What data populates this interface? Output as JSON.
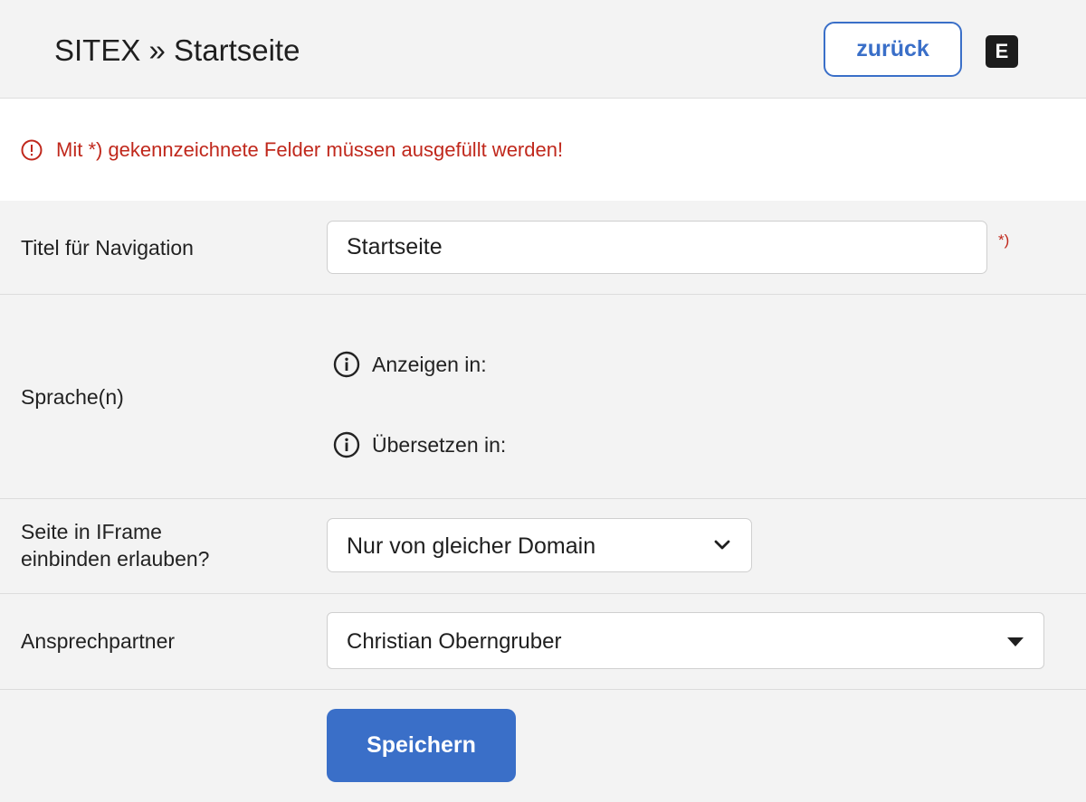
{
  "header": {
    "breadcrumb": "SITEX » Startseite",
    "back_label": "zurück",
    "badge_label": "E"
  },
  "alert": {
    "message": "Mit *) gekennzeichnete Felder müssen ausgefüllt werden!",
    "icon": "exclamation-circle-icon",
    "color": "#c0281c"
  },
  "form": {
    "nav_title": {
      "label": "Titel für Navigation",
      "value": "Startseite",
      "required_mark": "*)"
    },
    "languages": {
      "label": "Sprache(n)",
      "show_in_label": "Anzeigen in:",
      "translate_in_label": "Übersetzen in:",
      "icon": "info-circle-icon"
    },
    "iframe": {
      "label_line1": "Seite in IFrame",
      "label_line2": "einbinden erlauben?",
      "selected": "Nur von gleicher Domain",
      "icon": "chevron-down-icon"
    },
    "contact": {
      "label": "Ansprechpartner",
      "selected": "Christian Oberngruber",
      "icon": "caret-down-icon"
    },
    "save_label": "Speichern"
  },
  "colors": {
    "accent": "#3a6fc8",
    "error": "#c0281c",
    "background": "#f3f3f3",
    "badge": "#1c1c1c"
  }
}
